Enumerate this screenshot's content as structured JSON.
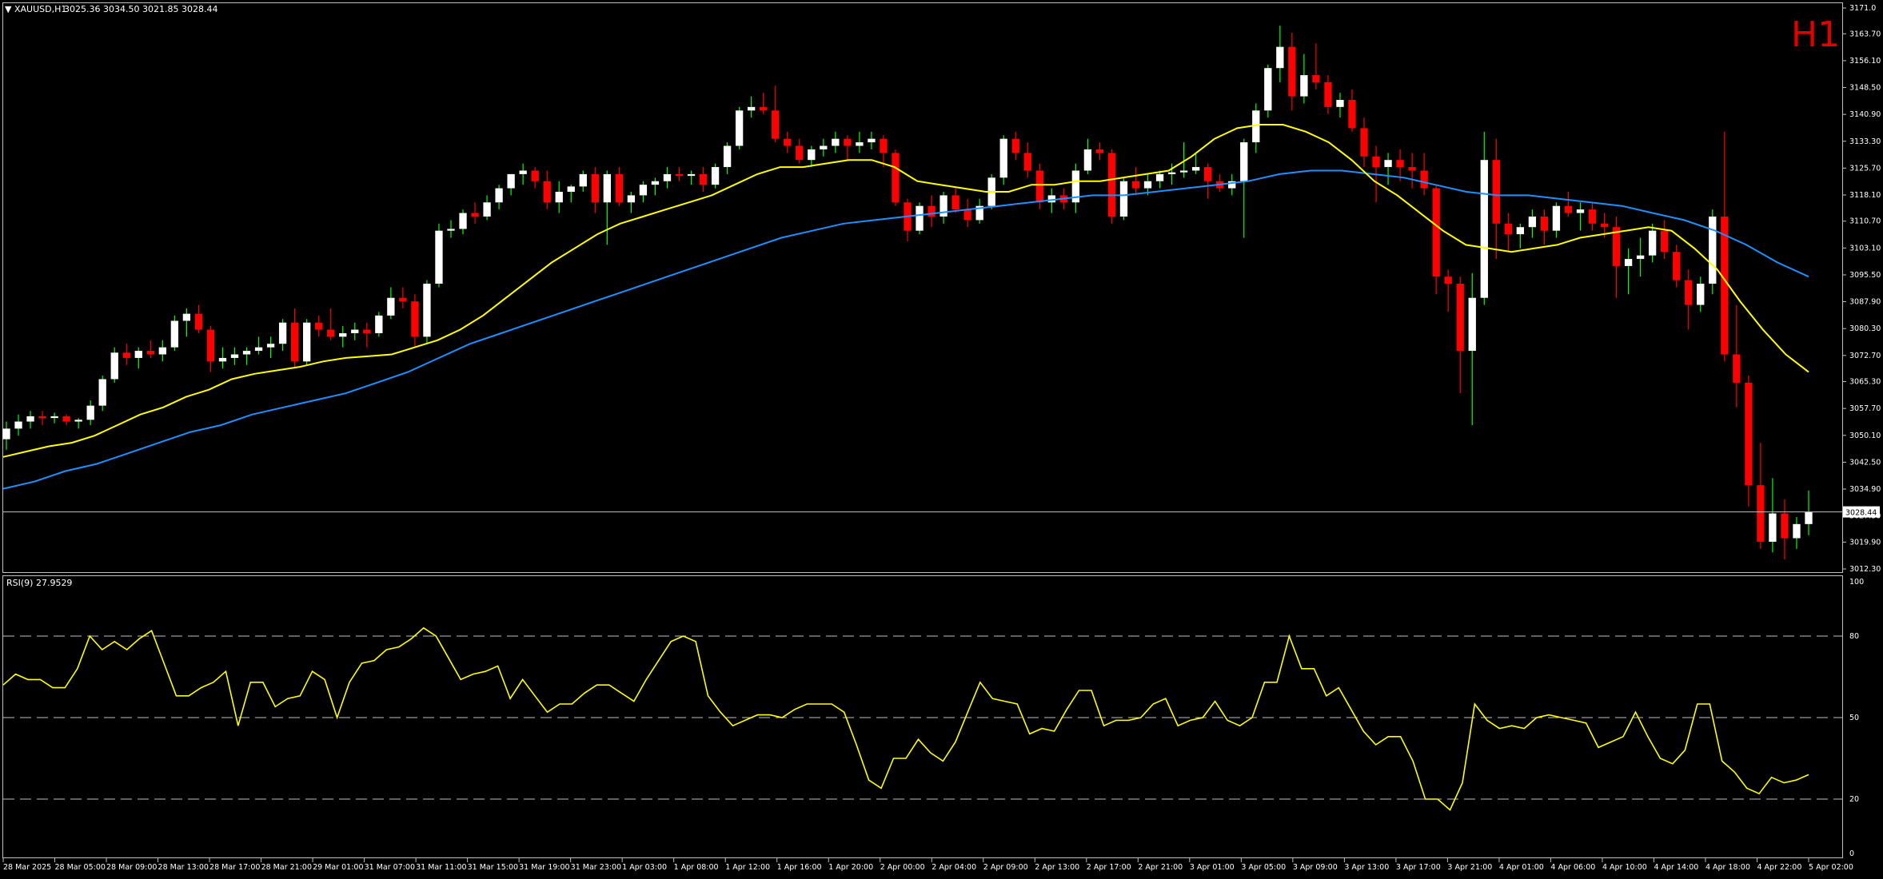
{
  "header": {
    "symbol_period": "XAUUSD,H1",
    "ohlc": "3025.36 3034.50 3021.85 3028.44",
    "period_badge": "H1"
  },
  "indicator": {
    "label": "RSI(9) 27.9529",
    "scale_labels": [
      "100",
      "80",
      "50",
      "20",
      "0"
    ],
    "levels": [
      80,
      50,
      20
    ],
    "color": "#ffff00"
  },
  "colors": {
    "background": "#000000",
    "bull_candle": "#ffffff",
    "bear_candle": "#ff0000",
    "wick_bull": "#00ff00",
    "wick_bear": "#ff0000",
    "ma_fast": "#ffff00",
    "ma_slow": "#1e90ff",
    "grid_frame": "#c0c0c0",
    "price_line": "#c0c0c0"
  },
  "chart_data": {
    "type": "candlestick",
    "price_axis": {
      "range": [
        3012.3,
        3171.0
      ],
      "ticks": [
        "3171.0",
        "3163.70",
        "3156.10",
        "3148.50",
        "3140.90",
        "3133.30",
        "3125.70",
        "3118.10",
        "3110.70",
        "3103.10",
        "3095.50",
        "3087.90",
        "3080.30",
        "3072.70",
        "3065.30",
        "3057.70",
        "3050.10",
        "3042.50",
        "3034.90",
        "3027.30",
        "3019.90",
        "3012.30"
      ],
      "current_price": "3028.44"
    },
    "time_axis": [
      "28 Mar 2025",
      "28 Mar 05:00",
      "28 Mar 09:00",
      "28 Mar 13:00",
      "28 Mar 17:00",
      "28 Mar 21:00",
      "29 Mar 01:00",
      "31 Mar 07:00",
      "31 Mar 11:00",
      "31 Mar 15:00",
      "31 Mar 19:00",
      "31 Mar 23:00",
      "1 Apr 03:00",
      "1 Apr 08:00",
      "1 Apr 12:00",
      "1 Apr 16:00",
      "1 Apr 20:00",
      "2 Apr 00:00",
      "2 Apr 04:00",
      "2 Apr 09:00",
      "2 Apr 13:00",
      "2 Apr 17:00",
      "2 Apr 21:00",
      "3 Apr 01:00",
      "3 Apr 05:00",
      "3 Apr 09:00",
      "3 Apr 13:00",
      "3 Apr 17:00",
      "3 Apr 21:00",
      "4 Apr 01:00",
      "4 Apr 06:00",
      "4 Apr 10:00",
      "4 Apr 14:00",
      "4 Apr 18:00",
      "4 Apr 22:00",
      "5 Apr 02:00"
    ],
    "candles": [
      [
        3049.0,
        3054.0,
        3046.0,
        3052.0
      ],
      [
        3052.0,
        3056.0,
        3050.0,
        3054.0
      ],
      [
        3054.0,
        3057.0,
        3052.0,
        3055.5
      ],
      [
        3055.5,
        3057.0,
        3053.0,
        3055.0
      ],
      [
        3055.0,
        3056.5,
        3053.5,
        3055.5
      ],
      [
        3055.5,
        3056.0,
        3053.0,
        3054.0
      ],
      [
        3054.0,
        3055.0,
        3052.0,
        3054.5
      ],
      [
        3054.5,
        3060.0,
        3053.0,
        3058.5
      ],
      [
        3058.5,
        3067.0,
        3057.0,
        3066.0
      ],
      [
        3066.0,
        3075.0,
        3065.0,
        3073.5
      ],
      [
        3073.5,
        3076.0,
        3070.0,
        3072.0
      ],
      [
        3072.0,
        3075.0,
        3069.0,
        3074.0
      ],
      [
        3074.0,
        3077.0,
        3072.0,
        3073.0
      ],
      [
        3073.0,
        3077.0,
        3071.0,
        3075.0
      ],
      [
        3075.0,
        3084.0,
        3074.0,
        3082.5
      ],
      [
        3082.5,
        3086.0,
        3078.0,
        3084.5
      ],
      [
        3084.5,
        3087.0,
        3079.0,
        3080.0
      ],
      [
        3080.0,
        3081.0,
        3068.0,
        3071.0
      ],
      [
        3071.0,
        3075.0,
        3069.0,
        3072.0
      ],
      [
        3072.0,
        3075.0,
        3070.0,
        3073.0
      ],
      [
        3073.0,
        3075.0,
        3070.0,
        3074.0
      ],
      [
        3074.0,
        3078.0,
        3073.0,
        3075.0
      ],
      [
        3075.0,
        3078.0,
        3072.0,
        3076.0
      ],
      [
        3076.0,
        3083.0,
        3074.0,
        3082.0
      ],
      [
        3082.0,
        3086.0,
        3069.0,
        3071.0
      ],
      [
        3071.0,
        3083.0,
        3070.0,
        3082.0
      ],
      [
        3082.0,
        3084.0,
        3078.0,
        3080.0
      ],
      [
        3080.0,
        3086.0,
        3077.0,
        3078.0
      ],
      [
        3078.0,
        3081.0,
        3075.0,
        3079.0
      ],
      [
        3079.0,
        3082.0,
        3077.0,
        3080.0
      ],
      [
        3080.0,
        3082.0,
        3075.0,
        3079.0
      ],
      [
        3079.0,
        3085.0,
        3078.0,
        3084.0
      ],
      [
        3084.0,
        3092.0,
        3083.0,
        3089.0
      ],
      [
        3089.0,
        3092.0,
        3086.0,
        3088.0
      ],
      [
        3088.0,
        3090.0,
        3075.0,
        3078.0
      ],
      [
        3078.0,
        3094.0,
        3076.0,
        3093.0
      ],
      [
        3093.0,
        3110.0,
        3092.0,
        3108.0
      ],
      [
        3108.0,
        3111.0,
        3106.0,
        3108.5
      ],
      [
        3108.5,
        3114.0,
        3107.0,
        3113.0
      ],
      [
        3113.0,
        3116.0,
        3110.0,
        3112.0
      ],
      [
        3112.0,
        3118.0,
        3111.0,
        3116.0
      ],
      [
        3116.0,
        3121.0,
        3114.0,
        3120.0
      ],
      [
        3120.0,
        3124.0,
        3118.0,
        3124.0
      ],
      [
        3124.0,
        3127.0,
        3121.0,
        3125.0
      ],
      [
        3125.0,
        3126.0,
        3120.0,
        3122.0
      ],
      [
        3122.0,
        3125.0,
        3114.0,
        3116.0
      ],
      [
        3116.0,
        3122.0,
        3113.0,
        3119.0
      ],
      [
        3119.0,
        3121.0,
        3116.0,
        3120.5
      ],
      [
        3120.5,
        3125.0,
        3119.0,
        3124.0
      ],
      [
        3124.0,
        3126.0,
        3113.0,
        3116.0
      ],
      [
        3116.0,
        3125.0,
        3104.0,
        3124.0
      ],
      [
        3124.0,
        3126.0,
        3115.0,
        3116.0
      ],
      [
        3116.0,
        3119.0,
        3113.0,
        3118.0
      ],
      [
        3118.0,
        3122.0,
        3116.0,
        3121.0
      ],
      [
        3121.0,
        3123.0,
        3118.0,
        3122.0
      ],
      [
        3122.0,
        3126.0,
        3120.0,
        3124.0
      ],
      [
        3124.0,
        3126.0,
        3122.0,
        3123.5
      ],
      [
        3123.5,
        3125.0,
        3121.0,
        3124.0
      ],
      [
        3124.0,
        3126.0,
        3119.0,
        3121.0
      ],
      [
        3121.0,
        3127.0,
        3120.0,
        3126.0
      ],
      [
        3126.0,
        3133.0,
        3124.0,
        3132.0
      ],
      [
        3132.0,
        3143.0,
        3131.0,
        3142.0
      ],
      [
        3142.0,
        3146.0,
        3140.0,
        3143.0
      ],
      [
        3143.0,
        3147.0,
        3141.0,
        3142.0
      ],
      [
        3142.0,
        3149.0,
        3133.0,
        3134.0
      ],
      [
        3134.0,
        3136.0,
        3130.0,
        3132.0
      ],
      [
        3132.0,
        3134.0,
        3127.0,
        3128.0
      ],
      [
        3128.0,
        3132.0,
        3126.0,
        3131.0
      ],
      [
        3131.0,
        3134.0,
        3129.0,
        3132.0
      ],
      [
        3132.0,
        3136.0,
        3130.0,
        3134.0
      ],
      [
        3134.0,
        3135.0,
        3128.0,
        3132.0
      ],
      [
        3132.0,
        3136.0,
        3130.0,
        3133.0
      ],
      [
        3133.0,
        3136.0,
        3131.0,
        3134.0
      ],
      [
        3134.0,
        3135.0,
        3126.0,
        3130.0
      ],
      [
        3130.0,
        3131.0,
        3115.0,
        3116.0
      ],
      [
        3116.0,
        3117.0,
        3105.0,
        3108.0
      ],
      [
        3108.0,
        3116.0,
        3107.0,
        3115.0
      ],
      [
        3115.0,
        3118.0,
        3109.0,
        3112.0
      ],
      [
        3112.0,
        3119.0,
        3110.0,
        3118.0
      ],
      [
        3118.0,
        3120.0,
        3113.0,
        3114.0
      ],
      [
        3114.0,
        3117.0,
        3109.0,
        3111.0
      ],
      [
        3111.0,
        3117.0,
        3110.0,
        3115.0
      ],
      [
        3115.0,
        3124.0,
        3114.0,
        3123.0
      ],
      [
        3123.0,
        3135.0,
        3121.0,
        3134.0
      ],
      [
        3134.0,
        3136.0,
        3128.0,
        3130.0
      ],
      [
        3130.0,
        3133.0,
        3123.0,
        3125.0
      ],
      [
        3125.0,
        3127.0,
        3114.0,
        3116.0
      ],
      [
        3116.0,
        3120.0,
        3113.0,
        3118.0
      ],
      [
        3118.0,
        3120.0,
        3114.0,
        3116.0
      ],
      [
        3116.0,
        3127.0,
        3113.0,
        3125.0
      ],
      [
        3125.0,
        3134.0,
        3124.0,
        3131.0
      ],
      [
        3131.0,
        3133.0,
        3128.0,
        3130.0
      ],
      [
        3130.0,
        3131.0,
        3110.0,
        3112.0
      ],
      [
        3112.0,
        3123.0,
        3111.0,
        3122.0
      ],
      [
        3122.0,
        3126.0,
        3118.0,
        3120.0
      ],
      [
        3120.0,
        3124.0,
        3118.0,
        3122.0
      ],
      [
        3122.0,
        3125.0,
        3120.0,
        3124.0
      ],
      [
        3124.0,
        3127.0,
        3121.0,
        3124.5
      ],
      [
        3124.5,
        3133.0,
        3123.0,
        3125.0
      ],
      [
        3125.0,
        3130.0,
        3124.0,
        3126.0
      ],
      [
        3126.0,
        3127.0,
        3117.0,
        3122.0
      ],
      [
        3122.0,
        3124.0,
        3119.0,
        3120.0
      ],
      [
        3120.0,
        3124.0,
        3118.0,
        3122.0
      ],
      [
        3122.0,
        3134.0,
        3106.0,
        3133.0
      ],
      [
        3133.0,
        3144.0,
        3130.0,
        3142.0
      ],
      [
        3142.0,
        3155.0,
        3140.0,
        3154.0
      ],
      [
        3154.0,
        3166.0,
        3150.0,
        3160.0
      ],
      [
        3160.0,
        3164.0,
        3142.0,
        3146.0
      ],
      [
        3146.0,
        3158.0,
        3144.0,
        3152.0
      ],
      [
        3152.0,
        3161.0,
        3148.0,
        3150.0
      ],
      [
        3150.0,
        3152.0,
        3141.0,
        3143.0
      ],
      [
        3143.0,
        3147.0,
        3140.0,
        3145.0
      ],
      [
        3145.0,
        3148.0,
        3136.0,
        3137.0
      ],
      [
        3137.0,
        3140.0,
        3126.0,
        3129.0
      ],
      [
        3129.0,
        3132.0,
        3116.0,
        3126.0
      ],
      [
        3126.0,
        3130.0,
        3121.0,
        3128.0
      ],
      [
        3128.0,
        3131.0,
        3122.0,
        3126.0
      ],
      [
        3126.0,
        3130.0,
        3120.0,
        3125.0
      ],
      [
        3125.0,
        3130.0,
        3118.0,
        3120.0
      ],
      [
        3120.0,
        3121.0,
        3090.0,
        3095.0
      ],
      [
        3095.0,
        3097.0,
        3085.0,
        3093.0
      ],
      [
        3093.0,
        3095.0,
        3062.0,
        3074.0
      ],
      [
        3074.0,
        3096.0,
        3053.0,
        3089.0
      ],
      [
        3089.0,
        3136.0,
        3087.0,
        3128.0
      ],
      [
        3128.0,
        3134.0,
        3100.0,
        3110.0
      ],
      [
        3110.0,
        3113.0,
        3102.0,
        3107.0
      ],
      [
        3107.0,
        3110.0,
        3103.0,
        3109.0
      ],
      [
        3109.0,
        3114.0,
        3106.0,
        3112.0
      ],
      [
        3112.0,
        3114.0,
        3104.0,
        3108.0
      ],
      [
        3108.0,
        3116.0,
        3106.0,
        3115.0
      ],
      [
        3115.0,
        3119.0,
        3112.0,
        3113.0
      ],
      [
        3113.0,
        3116.0,
        3108.0,
        3114.0
      ],
      [
        3114.0,
        3116.0,
        3108.0,
        3110.0
      ],
      [
        3110.0,
        3113.0,
        3106.0,
        3109.0
      ],
      [
        3109.0,
        3112.0,
        3089.0,
        3098.0
      ],
      [
        3098.0,
        3103.0,
        3090.0,
        3100.0
      ],
      [
        3100.0,
        3106.0,
        3095.0,
        3101.0
      ],
      [
        3101.0,
        3110.0,
        3099.0,
        3108.0
      ],
      [
        3108.0,
        3111.0,
        3100.0,
        3102.0
      ],
      [
        3102.0,
        3104.0,
        3092.0,
        3094.0
      ],
      [
        3094.0,
        3097.0,
        3080.0,
        3087.0
      ],
      [
        3087.0,
        3095.0,
        3085.0,
        3093.0
      ],
      [
        3093.0,
        3114.0,
        3090.0,
        3112.0
      ],
      [
        3112.0,
        3136.0,
        3071.0,
        3073.0
      ],
      [
        3073.0,
        3087.0,
        3058.0,
        3065.0
      ],
      [
        3065.0,
        3067.0,
        3030.0,
        3036.0
      ],
      [
        3036.0,
        3048.0,
        3018.0,
        3020.0
      ],
      [
        3020.0,
        3038.0,
        3017.0,
        3028.0
      ],
      [
        3028.0,
        3032.0,
        3015.0,
        3021.0
      ],
      [
        3021.0,
        3027.0,
        3018.0,
        3025.0
      ],
      [
        3025.0,
        3034.5,
        3021.85,
        3028.44
      ]
    ],
    "series": [
      {
        "name": "MA fast",
        "values": [
          3044,
          3045.5,
          3047,
          3048,
          3050,
          3053,
          3056,
          3058,
          3061,
          3063,
          3066,
          3067.5,
          3068.5,
          3069.5,
          3071,
          3072,
          3072.5,
          3073,
          3075,
          3077,
          3080,
          3084,
          3089,
          3094,
          3099,
          3103,
          3107,
          3110,
          3112,
          3114,
          3116,
          3118,
          3121,
          3124,
          3126,
          3126,
          3127,
          3128,
          3128,
          3126,
          3122,
          3121,
          3120,
          3119,
          3119,
          3121,
          3121,
          3122,
          3122,
          3123,
          3124,
          3125,
          3129,
          3134,
          3137,
          3138,
          3138,
          3136,
          3133,
          3128,
          3122,
          3118,
          3113,
          3108,
          3104,
          3103,
          3102,
          3103,
          3104,
          3106,
          3107,
          3108,
          3109,
          3108,
          3103,
          3097,
          3088,
          3080,
          3073,
          3068
        ]
      },
      {
        "name": "MA slow",
        "values": [
          3035,
          3037,
          3040,
          3042,
          3045,
          3048,
          3051,
          3053,
          3056,
          3058,
          3060,
          3062,
          3065,
          3068,
          3072,
          3076,
          3079,
          3082,
          3085,
          3088,
          3091,
          3094,
          3097,
          3100,
          3103,
          3106,
          3108,
          3110,
          3111,
          3112,
          3113,
          3114,
          3115,
          3116,
          3117,
          3118,
          3118,
          3119,
          3120,
          3121,
          3122,
          3124,
          3125,
          3125,
          3124,
          3123,
          3121,
          3119,
          3118,
          3118,
          3117,
          3116,
          3115,
          3113,
          3111,
          3108,
          3104,
          3099,
          3095
        ]
      },
      {
        "name": "RSI",
        "values": [
          62,
          66,
          64,
          64,
          61,
          61,
          68,
          80,
          75,
          78,
          75,
          79,
          82,
          70,
          58,
          58,
          61,
          63,
          67,
          47,
          63,
          63,
          54,
          57,
          58,
          67,
          64,
          50,
          63,
          70,
          71,
          75,
          76,
          79,
          83,
          80,
          72,
          64,
          66,
          67,
          69,
          57,
          64,
          58,
          52,
          55,
          55,
          59,
          62,
          62,
          59,
          56,
          64,
          71,
          78,
          80,
          78,
          58,
          52,
          47,
          49,
          51,
          51,
          50,
          53,
          55,
          55,
          55,
          52,
          40,
          27,
          24,
          35,
          35,
          42,
          37,
          34,
          41,
          52,
          63,
          57,
          56,
          55,
          44,
          46,
          45,
          53,
          60,
          60,
          47,
          49,
          49,
          50,
          55,
          57,
          47,
          49,
          50,
          56,
          49,
          47,
          50,
          63,
          63,
          80,
          68,
          68,
          58,
          61,
          53,
          45,
          40,
          43,
          43,
          34,
          20,
          20,
          16,
          26,
          55,
          49,
          46,
          47,
          46,
          50,
          51,
          50,
          49,
          48,
          39,
          41,
          43,
          52,
          43,
          35,
          33,
          38,
          55,
          55,
          34,
          30,
          24,
          22,
          28,
          26,
          27,
          29
        ]
      }
    ],
    "title": "XAUUSD,H1"
  }
}
